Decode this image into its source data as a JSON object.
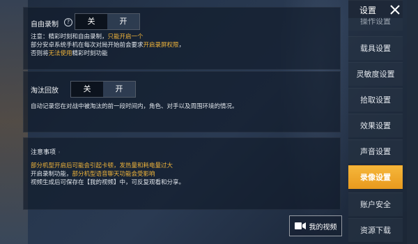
{
  "header": {
    "title": "设置"
  },
  "sidebar": {
    "items": [
      {
        "label": "操作设置"
      },
      {
        "label": "载具设置"
      },
      {
        "label": "灵敏度设置"
      },
      {
        "label": "拾取设置"
      },
      {
        "label": "效果设置"
      },
      {
        "label": "声音设置"
      },
      {
        "label": "录像设置"
      },
      {
        "label": "账户安全"
      },
      {
        "label": "资源下载"
      }
    ],
    "active": "录像设置"
  },
  "free_record": {
    "label": "自由录制",
    "help": "?",
    "off_label": "关",
    "on_label": "开",
    "selected": "关",
    "note_line1_a": "注意：精彩时刻和自由录制，",
    "note_line1_b": "只能开启一个",
    "note_line2_a": "部分安卓系统手机在每次对局开始前会要求",
    "note_line2_b": "开启录屏权限",
    "note_line2_c": "，",
    "note_line3_a": "否则将",
    "note_line3_b": "无法使用",
    "note_line3_c": "精彩时刻功能"
  },
  "elim_replay": {
    "label": "淘汰回放",
    "off_label": "关",
    "on_label": "开",
    "selected": "关",
    "desc": "自动记录您在对战中被淘汰的前一段时间内，角色、对手以及周围环境的情况。"
  },
  "notes": {
    "title": "注意事项",
    "title_mark": "◦",
    "line1": "部分机型开启后可能会引起卡顿，发热量和耗电量过大",
    "line2_a": "开启录制功能，",
    "line2_b": "部分机型语音聊天功能会受影响",
    "line3": "视频生成后可保存在【我的视频】中，可反复观看和分享。"
  },
  "my_video_button": {
    "label": "我的视频"
  },
  "colors": {
    "accent": "#f0b43a",
    "active_tab": "#f2a92e"
  }
}
